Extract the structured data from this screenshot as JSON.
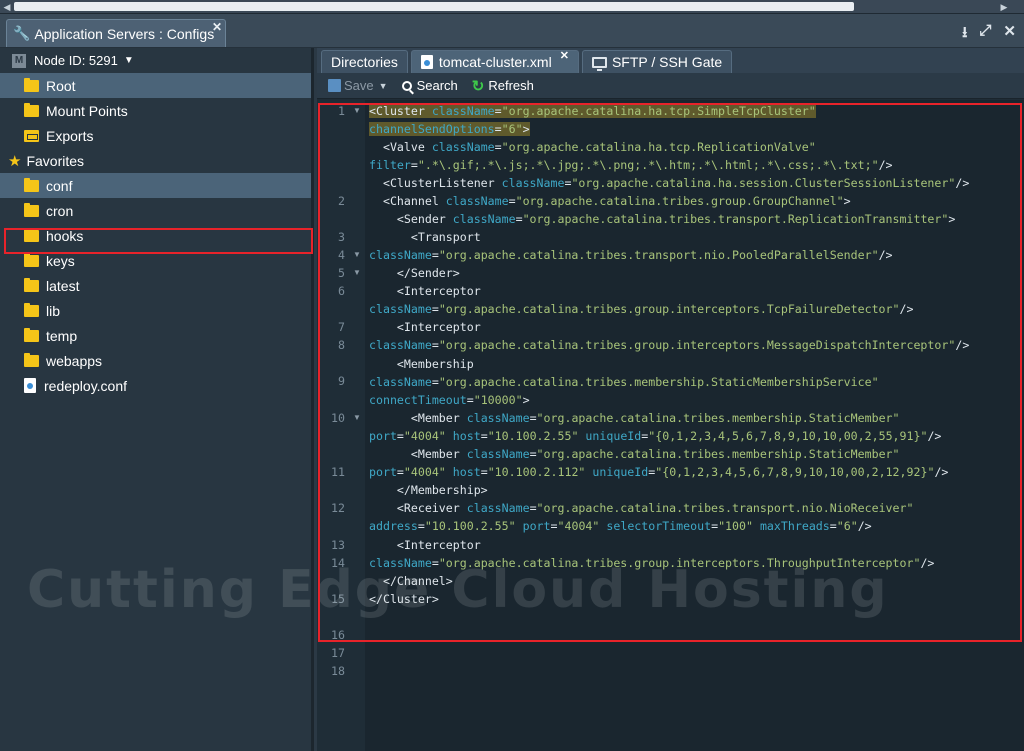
{
  "window": {
    "title": "Application Servers : Configs",
    "controls": [
      "download-icon",
      "expand-icon",
      "close-icon"
    ]
  },
  "sidebar": {
    "node_label": "Node ID: 5291",
    "items": [
      {
        "label": "Root",
        "icon": "folder-icon"
      },
      {
        "label": "Mount Points",
        "icon": "folder-icon"
      },
      {
        "label": "Exports",
        "icon": "export-folder-icon"
      }
    ],
    "favorites_label": "Favorites",
    "favorites": [
      {
        "label": "conf",
        "icon": "folder-icon"
      },
      {
        "label": "cron",
        "icon": "folder-icon"
      },
      {
        "label": "hooks",
        "icon": "folder-icon"
      },
      {
        "label": "keys",
        "icon": "folder-icon"
      },
      {
        "label": "latest",
        "icon": "folder-icon"
      },
      {
        "label": "lib",
        "icon": "folder-icon"
      },
      {
        "label": "temp",
        "icon": "folder-icon"
      },
      {
        "label": "webapps",
        "icon": "folder-icon"
      },
      {
        "label": "redeploy.conf",
        "icon": "file-icon"
      }
    ]
  },
  "tabs": [
    {
      "label": "Directories"
    },
    {
      "label": "tomcat-cluster.xml"
    },
    {
      "label": "SFTP / SSH Gate"
    }
  ],
  "toolbar": {
    "save_label": "Save",
    "search_label": "Search",
    "refresh_label": "Refresh"
  },
  "editor": {
    "line_numbers": [
      "1",
      "2",
      "3",
      "4",
      "5",
      "6",
      "7",
      "8",
      "9",
      "10",
      "11",
      "12",
      "13",
      "14",
      "15",
      "16",
      "17",
      "18"
    ]
  },
  "watermark": {
    "brand": "Cutting Edge Cloud Hosting"
  },
  "colors": {
    "highlight": "#e8232a",
    "folder": "#f5c518",
    "attribute": "#3fa8c7",
    "value": "#a8c47a"
  }
}
